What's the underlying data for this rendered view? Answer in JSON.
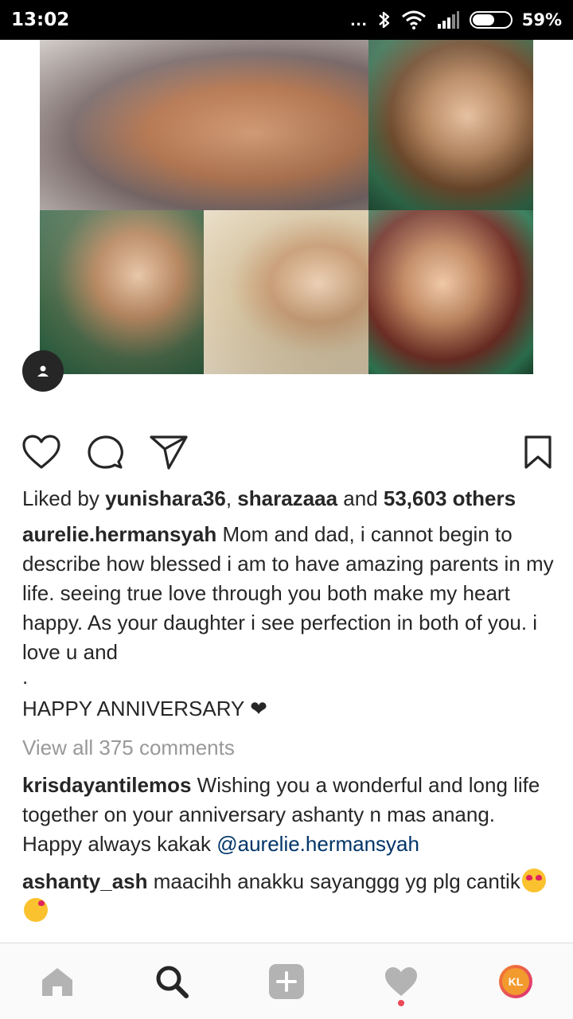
{
  "status_bar": {
    "time": "13:02",
    "dots": "...",
    "battery_text": "59%",
    "battery_level": 0.59,
    "icons": [
      "bluetooth-icon",
      "wifi-icon",
      "signal-icon",
      "battery-icon"
    ]
  },
  "post": {
    "likes": {
      "prefix": "Liked by ",
      "user1": "yunishara36",
      "sep": ", ",
      "user2": "sharazaaa",
      "and": " and ",
      "others": "53,603 others"
    },
    "caption": {
      "username": "aurelie.hermansyah",
      "text": " Mom and dad, i cannot begin to describe how blessed i am to have amazing parents in my life. seeing true love through you both make my heart happy. As your daughter i see perfection in both of you. i love u and",
      "dot": ".",
      "anniversary": "HAPPY ANNIVERSARY ❤"
    },
    "view_comments": "View all 375 comments",
    "comments": [
      {
        "username": "krisdayantilemos",
        "text": " Wishing you a wonderful and long life together on your anniversary ashanty n mas anang. Happy always kakak ",
        "mention": "@aurelie.hermansyah"
      },
      {
        "username": "ashanty_ash",
        "text": " maacihh anakku sayanggg yg plg cantik"
      }
    ]
  },
  "nav": {
    "avatar_initials": "KL",
    "items": [
      "home-icon",
      "search-icon",
      "add-post-icon",
      "activity-heart-icon",
      "profile-avatar"
    ]
  },
  "colors": {
    "text": "#262626",
    "muted": "#999999",
    "mention": "#003569",
    "nav_icon_inactive": "#b3b3b3",
    "notification": "#ed4956"
  }
}
